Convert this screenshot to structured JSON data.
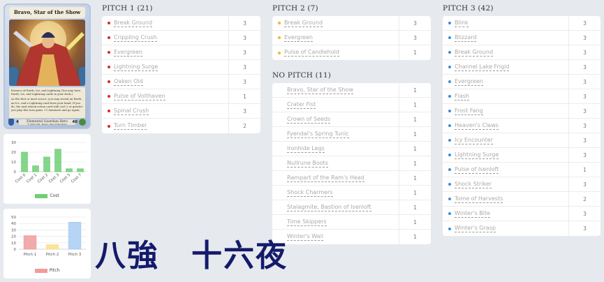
{
  "hero": {
    "title": "Bravo, Star of the Show",
    "text1": "Essence of Earth, Ice, and Lightning (You may have Earth, Ice, and Lightning cards in your deck.)",
    "text2": "As the first or most scarce, you may reveal an Earth, an Ice, and a Lightning card from your hand. If you do, the next attack action card with cost 2 or greater you play this turn gains +1 dominate and go again.",
    "type_line": "Elemental Guardian Hero",
    "defense": "4",
    "life": "40",
    "footer": "© 2022 LSS · Bravo, Star of the Show"
  },
  "cost_chart": {
    "chart_data": {
      "type": "bar",
      "categories": [
        "Cost 0",
        "Cost 1",
        "Cost 2",
        "Cost 3",
        "Cost 5",
        "Cost 7"
      ],
      "values": [
        20,
        6,
        15,
        23,
        3,
        3
      ],
      "ylim": [
        0,
        30
      ],
      "yticks": [
        0,
        10,
        20,
        30
      ],
      "legend": "Cost",
      "color": "#6fcf74"
    }
  },
  "pitch_chart": {
    "chart_data": {
      "type": "bar",
      "categories": [
        "Pitch 1",
        "Pitch 2",
        "Pitch 3"
      ],
      "values": [
        21,
        7,
        42
      ],
      "ylim": [
        0,
        50
      ],
      "yticks": [
        0,
        10,
        20,
        30,
        40,
        50
      ],
      "legend": "Pitch",
      "colors": [
        "#f09c9c",
        "#f7e08a",
        "#a9cdf3"
      ]
    }
  },
  "pitch1": {
    "title": "PITCH 1 (21)",
    "dot_color": "#d62a2a",
    "cards": [
      {
        "name": "Break Ground",
        "qty": "3"
      },
      {
        "name": "Crippling Crush",
        "qty": "3"
      },
      {
        "name": "Evergreen",
        "qty": "3"
      },
      {
        "name": "Lightning Surge",
        "qty": "3"
      },
      {
        "name": "Oaken Old",
        "qty": "3"
      },
      {
        "name": "Pulse of Volthaven",
        "qty": "1"
      },
      {
        "name": "Spinal Crush",
        "qty": "3"
      },
      {
        "name": "Turn Timber",
        "qty": "2"
      }
    ]
  },
  "pitch2": {
    "title": "PITCH 2 (7)",
    "dot_color": "#f3b72c",
    "cards": [
      {
        "name": "Break Ground",
        "qty": "3"
      },
      {
        "name": "Evergreen",
        "qty": "3"
      },
      {
        "name": "Pulse of Candlehold",
        "qty": "1"
      }
    ]
  },
  "nopitch": {
    "title": "NO PITCH (11)",
    "dot_color": "",
    "cards": [
      {
        "name": "Bravo, Star of the Show",
        "qty": "1"
      },
      {
        "name": "Crater Fist",
        "qty": "1"
      },
      {
        "name": "Crown of Seeds",
        "qty": "1"
      },
      {
        "name": "Fyendal's Spring Tunic",
        "qty": "1"
      },
      {
        "name": "Ironhide Legs",
        "qty": "1"
      },
      {
        "name": "Nullrune Boots",
        "qty": "1"
      },
      {
        "name": "Rampart of the Ram's Head",
        "qty": "1"
      },
      {
        "name": "Shock Charmers",
        "qty": "1"
      },
      {
        "name": "Stalagmite, Bastion of Isenloft",
        "qty": "1"
      },
      {
        "name": "Time Skippers",
        "qty": "1"
      },
      {
        "name": "Winter's Wail",
        "qty": "1"
      }
    ]
  },
  "pitch3": {
    "title": "PITCH 3 (42)",
    "dot_color": "#3f8fd8",
    "cards": [
      {
        "name": "Blink",
        "qty": "3"
      },
      {
        "name": "Blizzard",
        "qty": "3"
      },
      {
        "name": "Break Ground",
        "qty": "3"
      },
      {
        "name": "Channel Lake Frigid",
        "qty": "3"
      },
      {
        "name": "Evergreen",
        "qty": "3"
      },
      {
        "name": "Flash",
        "qty": "3"
      },
      {
        "name": "Frost Fang",
        "qty": "3"
      },
      {
        "name": "Heaven's Claws",
        "qty": "3"
      },
      {
        "name": "Icy Encounter",
        "qty": "3"
      },
      {
        "name": "Lightning Surge",
        "qty": "3"
      },
      {
        "name": "Pulse of Isenloft",
        "qty": "1"
      },
      {
        "name": "Shock Striker",
        "qty": "3"
      },
      {
        "name": "Tome of Harvests",
        "qty": "2"
      },
      {
        "name": "Winter's Bite",
        "qty": "3"
      },
      {
        "name": "Winter's Grasp",
        "qty": "3"
      }
    ]
  },
  "overlay": {
    "text": "八強　十六夜"
  }
}
